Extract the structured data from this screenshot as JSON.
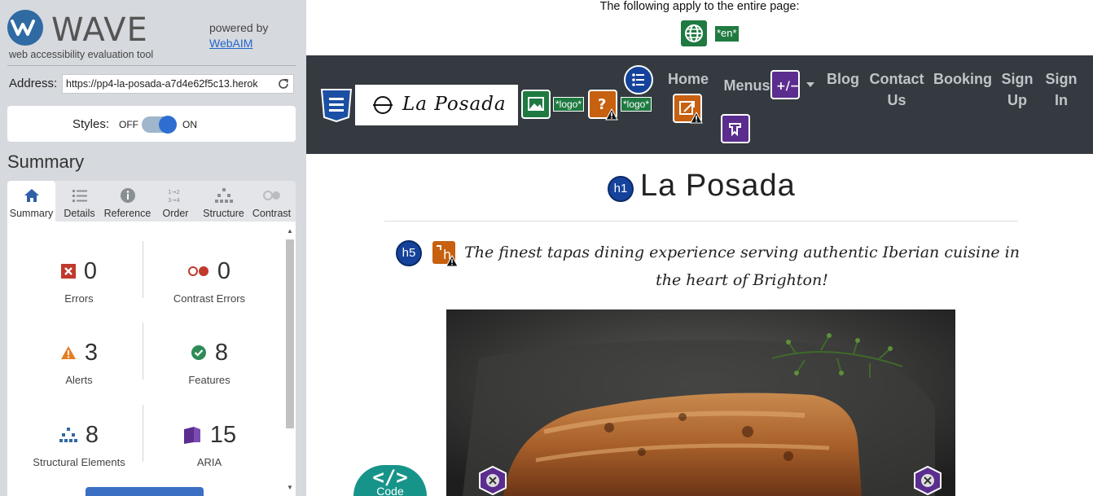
{
  "wave": {
    "app_name": "WAVE",
    "tagline": "web accessibility evaluation tool",
    "powered_by": "powered by",
    "webaim_link": "WebAIM"
  },
  "address": {
    "label": "Address:",
    "value": "https://pp4-la-posada-a7d4e62f5c13.herok"
  },
  "styles": {
    "label": "Styles:",
    "off": "OFF",
    "on": "ON",
    "enabled": true
  },
  "summary": {
    "heading": "Summary",
    "tabs": [
      {
        "label": "Summary",
        "icon": "home-icon",
        "active": true
      },
      {
        "label": "Details",
        "icon": "list-icon",
        "active": false
      },
      {
        "label": "Reference",
        "icon": "info-icon",
        "active": false
      },
      {
        "label": "Order",
        "icon": "order-icon",
        "active": false
      },
      {
        "label": "Structure",
        "icon": "structure-icon",
        "active": false
      },
      {
        "label": "Contrast",
        "icon": "contrast-icon",
        "active": false
      }
    ],
    "stats": {
      "errors": {
        "count": "0",
        "label": "Errors",
        "color": "#c0392b"
      },
      "contrast_errors": {
        "count": "0",
        "label": "Contrast Errors",
        "color": "#c0392b"
      },
      "alerts": {
        "count": "3",
        "label": "Alerts",
        "color": "#e67e22"
      },
      "features": {
        "count": "8",
        "label": "Features",
        "color": "#2e8b57"
      },
      "structural": {
        "count": "8",
        "label": "Structural Elements",
        "color": "#2f6aa3"
      },
      "aria": {
        "count": "15",
        "label": "ARIA",
        "color": "#5b2d8e"
      }
    }
  },
  "page_notice": {
    "text": "The following apply to the entire page:",
    "lang_tag": "*en*"
  },
  "site": {
    "brand": "La Posada",
    "logo_tag_1": "*logo*",
    "logo_tag_2": "*logo*",
    "nav": {
      "home": "Home",
      "menus": "Menus",
      "blog": "Blog",
      "contact": "Contact Us",
      "booking": "Booking",
      "signup": "Sign Up",
      "signin": "Sign In"
    },
    "h1_badge": "h1",
    "title": "La Posada",
    "h5_badge": "h5",
    "h_alert_glyph": "h",
    "subtitle": "The finest tapas dining experience serving authentic Iberian cuisine in the heart of Brighton!"
  },
  "code_toggle": {
    "glyph": "</>",
    "label": "Code"
  },
  "colors": {
    "sidebar_bg": "#d6d9dd",
    "navbar_bg": "#343a40",
    "feature_green": "#1f7a41",
    "aria_purple": "#5b2d8e",
    "alert_orange": "#c7600f",
    "structure_blue": "#15439c",
    "code_teal": "#17948a"
  }
}
